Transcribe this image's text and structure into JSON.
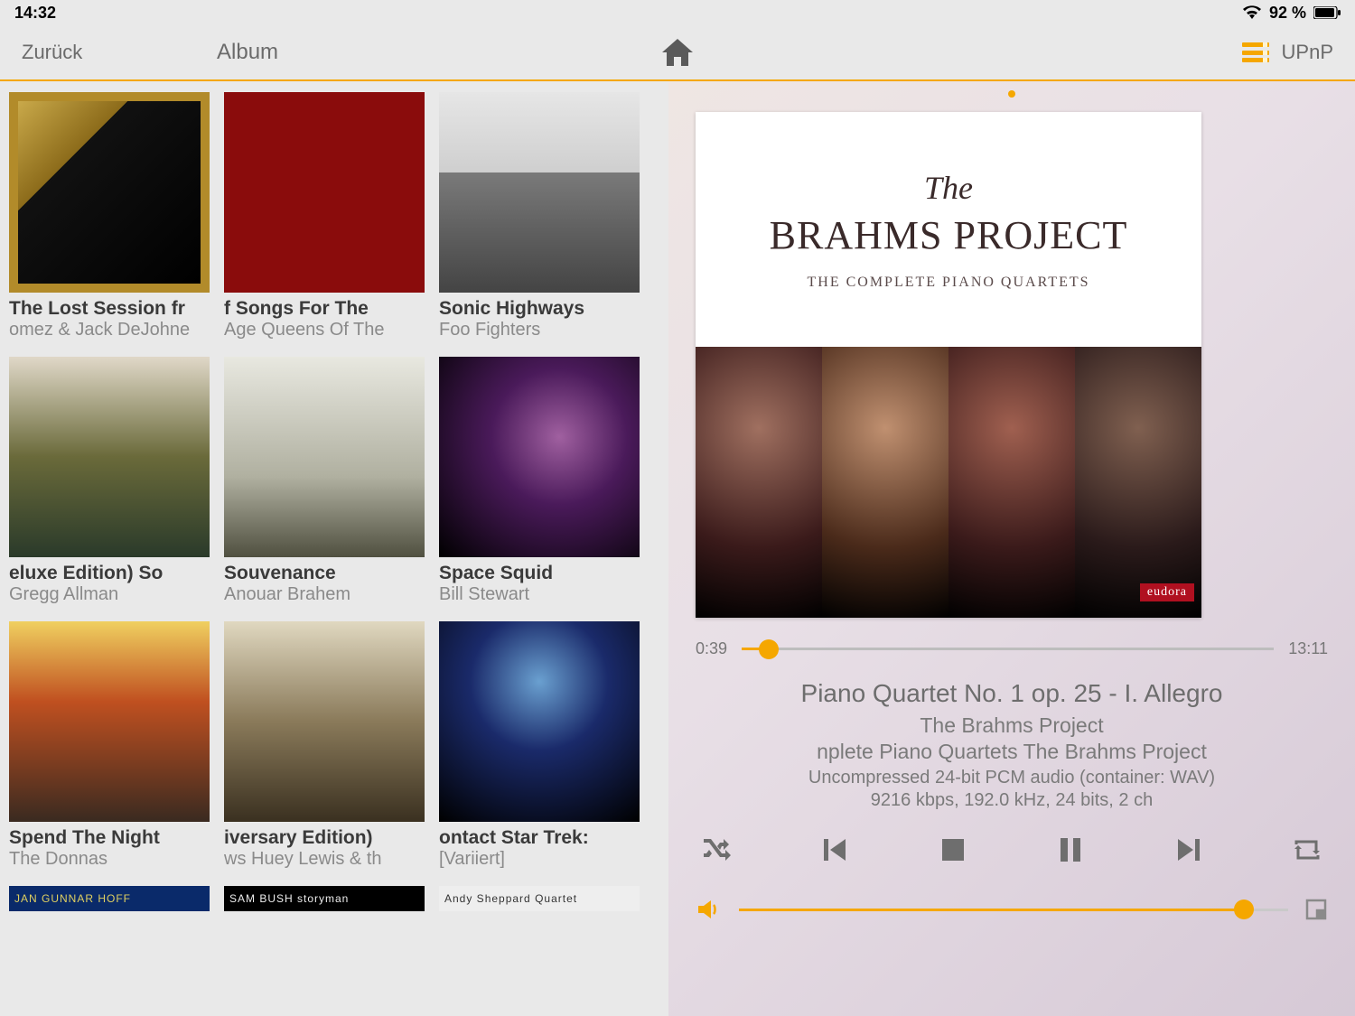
{
  "status_bar": {
    "time": "14:32",
    "battery_pct": "92 %"
  },
  "nav": {
    "back": "Zurück",
    "title": "Album",
    "server": "UPnP"
  },
  "albums": [
    {
      "title": "The Lost Session fr",
      "artist": "omez & Jack DeJohne"
    },
    {
      "title": "f      Songs For The",
      "artist": "Age      Queens Of The"
    },
    {
      "title": "Sonic Highways",
      "artist": "Foo Fighters"
    },
    {
      "title": "eluxe Edition)      So",
      "artist": "Gregg Allman"
    },
    {
      "title": "Souvenance",
      "artist": "Anouar Brahem"
    },
    {
      "title": "Space Squid",
      "artist": "Bill Stewart"
    },
    {
      "title": "Spend The Night",
      "artist": "The Donnas"
    },
    {
      "title": "iversary Edition)",
      "artist": "ws      Huey Lewis & th"
    },
    {
      "title": "ontact      Star Trek:",
      "artist": "[Variiert]"
    }
  ],
  "strip_labels": [
    "JAN GUNNAR HOFF",
    "SAM BUSH  storyman",
    "Andy Sheppard Quartet"
  ],
  "player": {
    "cover": {
      "the": "The",
      "title": "BRAHMS PROJECT",
      "sub": "THE COMPLETE PIANO QUARTETS",
      "badge": "eudora"
    },
    "time_elapsed": "0:39",
    "time_total": "13:11",
    "track": "Piano Quartet No. 1 op. 25 - I. Allegro",
    "artist": "The Brahms Project",
    "album_line": "nplete Piano Quartets          The Brahms Project",
    "format": "Uncompressed 24-bit PCM audio (container: WAV)",
    "bitrate": "9216 kbps, 192.0 kHz, 24 bits, 2 ch",
    "progress_pct": 5,
    "volume_pct": 92
  }
}
